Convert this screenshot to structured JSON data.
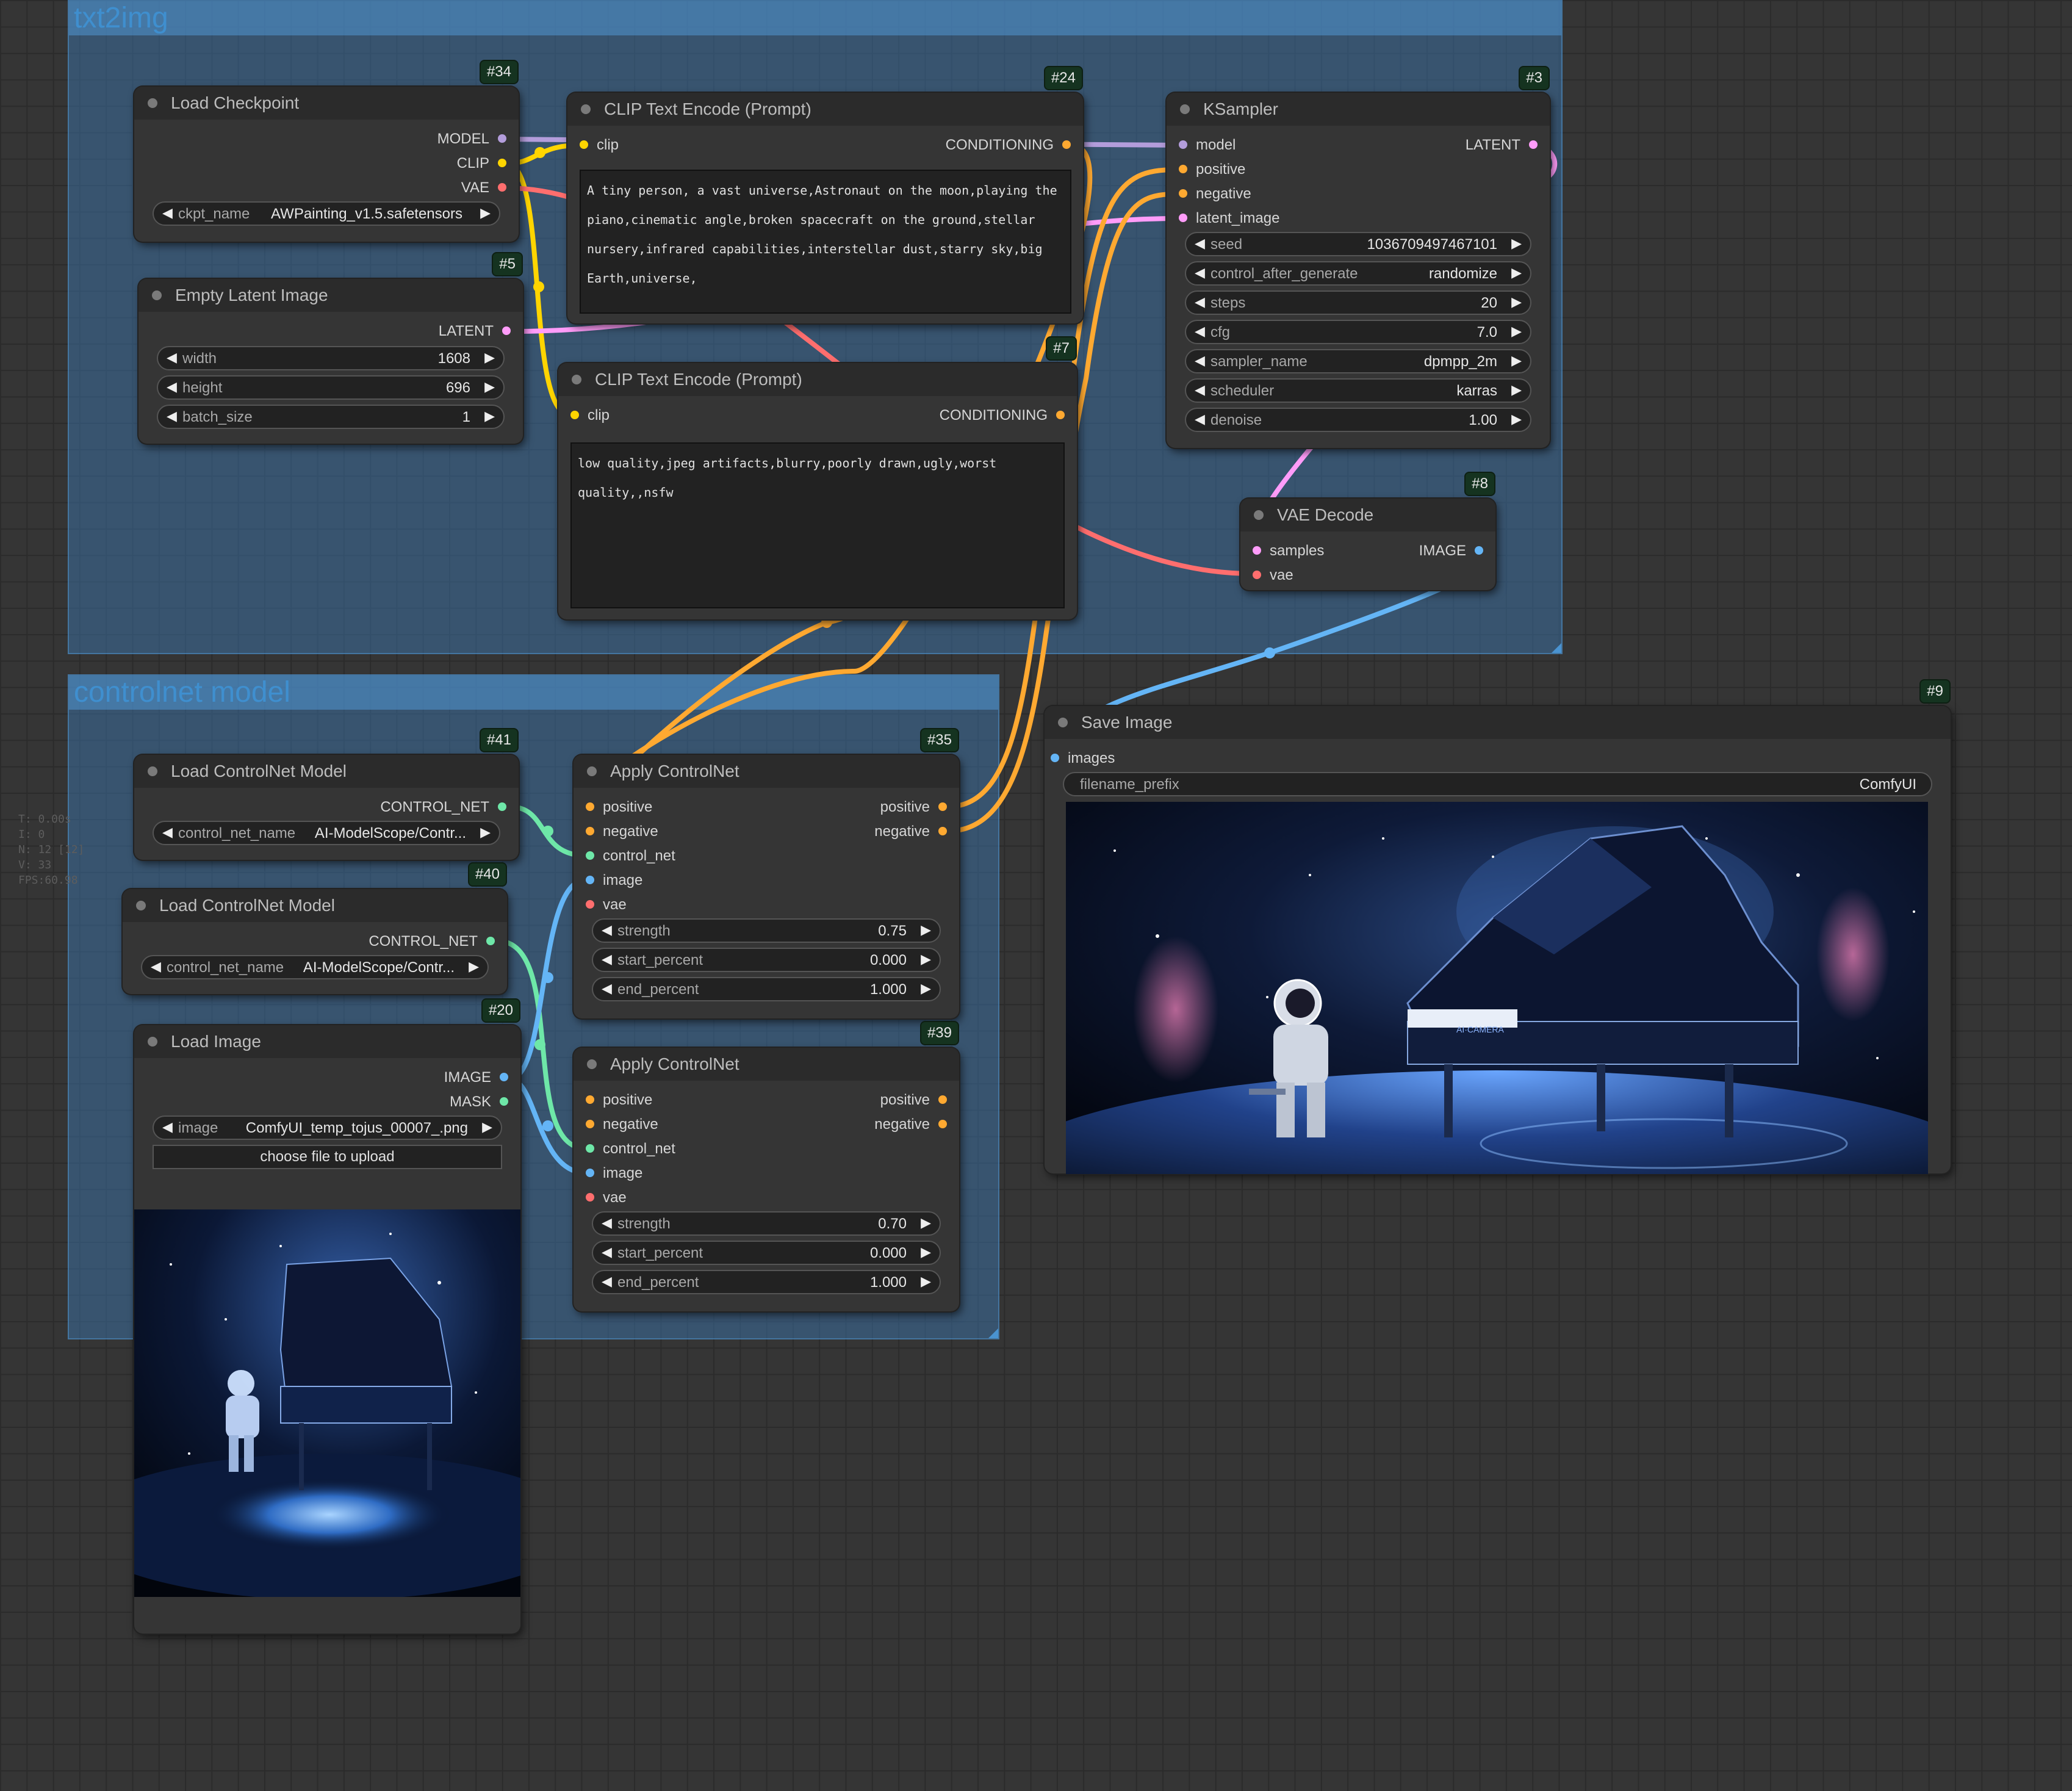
{
  "groups": {
    "txt2img": "txt2img",
    "controlnet": "controlnet model"
  },
  "stats": [
    "T: 0.00s",
    "I: 0",
    "N: 12 [12]",
    "V: 33",
    "FPS:60.98"
  ],
  "colors": {
    "clip": "#ffd500",
    "model": "#b39ddb",
    "vae": "#ff6e6e",
    "latent": "#ff9cf9",
    "conditioning": "#ffa931",
    "control_net": "#6ee7a8",
    "image": "#64b5f6"
  },
  "nodes": {
    "load_checkpoint": {
      "id": "#34",
      "title": "Load Checkpoint",
      "outputs": [
        "MODEL",
        "CLIP",
        "VAE"
      ],
      "widget": {
        "label": "ckpt_name",
        "value": "AWPainting_v1.5.safetensors"
      }
    },
    "empty_latent": {
      "id": "#5",
      "title": "Empty Latent Image",
      "outputs": [
        "LATENT"
      ],
      "widgets": [
        {
          "label": "width",
          "value": "1608"
        },
        {
          "label": "height",
          "value": "696"
        },
        {
          "label": "batch_size",
          "value": "1"
        }
      ]
    },
    "clip_pos": {
      "id": "#24",
      "title": "CLIP Text Encode (Prompt)",
      "input": "clip",
      "output": "CONDITIONING",
      "text": "A tiny person, a vast universe,Astronaut on the moon,playing the piano,cinematic angle,broken spacecraft on the ground,stellar nursery,infrared capabilities,interstellar dust,starry sky,big Earth,universe,"
    },
    "clip_neg": {
      "id": "#7",
      "title": "CLIP Text Encode (Prompt)",
      "input": "clip",
      "output": "CONDITIONING",
      "text": "low quality,jpeg artifacts,blurry,poorly drawn,ugly,worst quality,,nsfw"
    },
    "ksampler": {
      "id": "#3",
      "title": "KSampler",
      "inputs": [
        "model",
        "positive",
        "negative",
        "latent_image"
      ],
      "output": "LATENT",
      "widgets": [
        {
          "label": "seed",
          "value": "1036709497467101"
        },
        {
          "label": "control_after_generate",
          "value": "randomize"
        },
        {
          "label": "steps",
          "value": "20"
        },
        {
          "label": "cfg",
          "value": "7.0"
        },
        {
          "label": "sampler_name",
          "value": "dpmpp_2m"
        },
        {
          "label": "scheduler",
          "value": "karras"
        },
        {
          "label": "denoise",
          "value": "1.00"
        }
      ]
    },
    "vae_decode": {
      "id": "#8",
      "title": "VAE Decode",
      "inputs": [
        "samples",
        "vae"
      ],
      "output": "IMAGE"
    },
    "save_image": {
      "id": "#9",
      "title": "Save Image",
      "input": "images",
      "widget": {
        "label": "filename_prefix",
        "value": "ComfyUI"
      },
      "watermark": "AI·CAMERA"
    },
    "load_cn_41": {
      "id": "#41",
      "title": "Load ControlNet Model",
      "output": "CONTROL_NET",
      "widget": {
        "label": "control_net_name",
        "value": "AI-ModelScope/Contr..."
      }
    },
    "load_cn_40": {
      "id": "#40",
      "title": "Load ControlNet Model",
      "output": "CONTROL_NET",
      "widget": {
        "label": "control_net_name",
        "value": "AI-ModelScope/Contr..."
      }
    },
    "load_image": {
      "id": "#20",
      "title": "Load Image",
      "outputs": [
        "IMAGE",
        "MASK"
      ],
      "widget": {
        "label": "image",
        "value": "ComfyUI_temp_tojus_00007_.png"
      },
      "button": "choose file to upload"
    },
    "apply_cn_35": {
      "id": "#35",
      "title": "Apply ControlNet",
      "inputs": [
        "positive",
        "negative",
        "control_net",
        "image",
        "vae"
      ],
      "outputs": [
        "positive",
        "negative"
      ],
      "widgets": [
        {
          "label": "strength",
          "value": "0.75"
        },
        {
          "label": "start_percent",
          "value": "0.000"
        },
        {
          "label": "end_percent",
          "value": "1.000"
        }
      ]
    },
    "apply_cn_39": {
      "id": "#39",
      "title": "Apply ControlNet",
      "inputs": [
        "positive",
        "negative",
        "control_net",
        "image",
        "vae"
      ],
      "outputs": [
        "positive",
        "negative"
      ],
      "widgets": [
        {
          "label": "strength",
          "value": "0.70"
        },
        {
          "label": "start_percent",
          "value": "0.000"
        },
        {
          "label": "end_percent",
          "value": "1.000"
        }
      ]
    }
  }
}
